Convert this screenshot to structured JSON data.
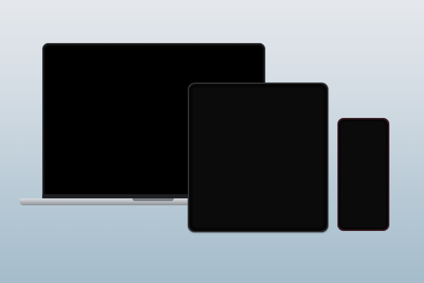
{
  "scene": {
    "type": "device-mockup",
    "background_colors": [
      "#e5e8ec",
      "#a5bccb"
    ],
    "devices": [
      {
        "kind": "laptop",
        "icon": "laptop-icon",
        "screen_color": "#000000"
      },
      {
        "kind": "tablet",
        "icon": "tablet-icon",
        "screen_color": "#0b0b0c"
      },
      {
        "kind": "phone",
        "icon": "phone-icon",
        "screen_color": "#0b0b0c"
      }
    ]
  }
}
